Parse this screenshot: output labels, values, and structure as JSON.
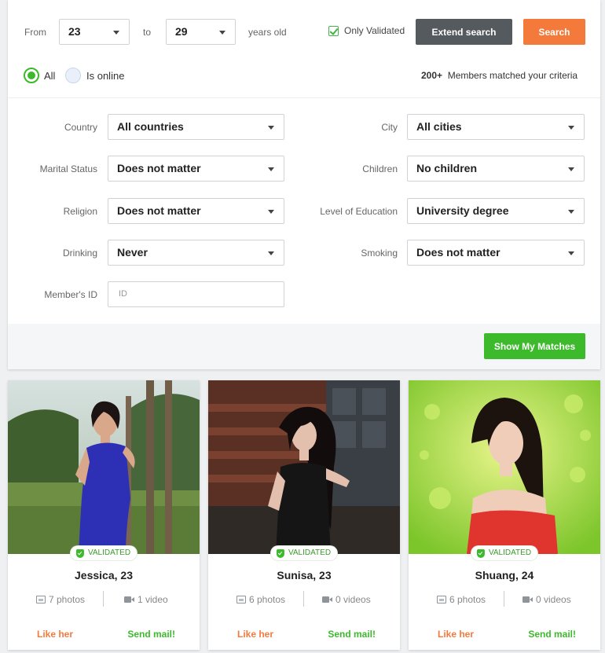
{
  "search": {
    "from_label": "From",
    "from_value": "23",
    "to_label": "to",
    "to_value": "29",
    "years_label": "years old",
    "only_validated_label": "Only Validated",
    "extend_button": "Extend search",
    "search_button": "Search",
    "radio_all": "All",
    "radio_online": "Is online",
    "match_count": "200+",
    "match_text": "Members matched your criteria"
  },
  "filters": {
    "country_label": "Country",
    "country_value": "All countries",
    "city_label": "City",
    "city_value": "All cities",
    "marital_label": "Marital Status",
    "marital_value": "Does not matter",
    "children_label": "Children",
    "children_value": "No children",
    "religion_label": "Religion",
    "religion_value": "Does not matter",
    "education_label": "Level of Education",
    "education_value": "University degree",
    "drinking_label": "Drinking",
    "drinking_value": "Never",
    "smoking_label": "Smoking",
    "smoking_value": "Does not matter",
    "member_id_label": "Member's ID",
    "member_id_placeholder": "ID",
    "show_matches_button": "Show My Matches"
  },
  "profiles": [
    {
      "badge": "VALIDATED",
      "name": "Jessica, 23",
      "photos": "7 photos",
      "videos": "1 video",
      "like": "Like her",
      "mail": "Send mail!"
    },
    {
      "badge": "VALIDATED",
      "name": "Sunisa, 23",
      "photos": "6 photos",
      "videos": "0 videos",
      "like": "Like her",
      "mail": "Send mail!"
    },
    {
      "badge": "VALIDATED",
      "name": "Shuang, 24",
      "photos": "6 photos",
      "videos": "0 videos",
      "like": "Like her",
      "mail": "Send mail!"
    }
  ],
  "colors": {
    "accent_green": "#3cba2c",
    "accent_orange": "#f47a3c",
    "button_dark": "#555a5f"
  }
}
